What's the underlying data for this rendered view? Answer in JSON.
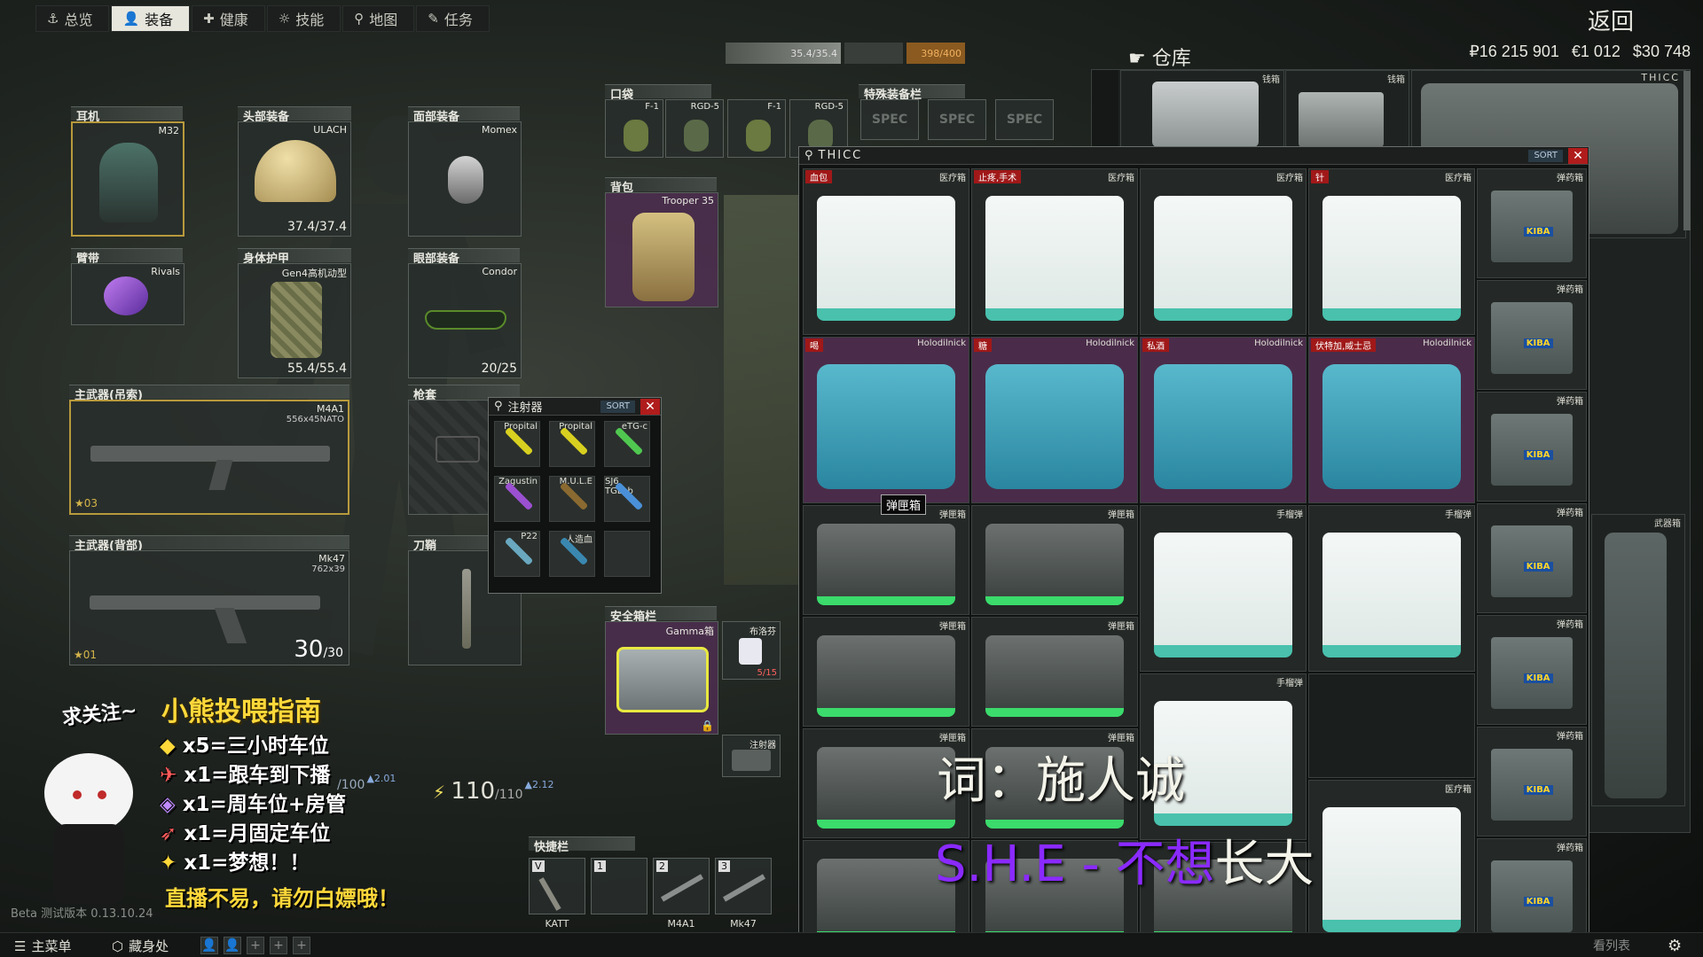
{
  "nav": {
    "tabs": [
      {
        "label": "总览",
        "icon": "anchor-icon"
      },
      {
        "label": "装备",
        "icon": "gear-person-icon"
      },
      {
        "label": "健康",
        "icon": "health-icon"
      },
      {
        "label": "技能",
        "icon": "skill-icon"
      },
      {
        "label": "地图",
        "icon": "map-pin-icon"
      },
      {
        "label": "任务",
        "icon": "task-icon"
      }
    ],
    "back_label": "返回"
  },
  "stash": {
    "title": "仓库",
    "rub": "₽16 215 901",
    "eur": "€1 012",
    "usd": "$30 748",
    "weight": "35.4/35.4",
    "weight2": "398/400"
  },
  "gear": {
    "earpiece": {
      "label": "耳机",
      "name": "M32"
    },
    "headwear": {
      "label": "头部装备",
      "name": "ULACH",
      "durability": "37.4/37.4"
    },
    "faceCover": {
      "label": "面部装备",
      "name": "Momex"
    },
    "armband": {
      "label": "臂带",
      "name": "Rivals"
    },
    "armor": {
      "label": "身体护甲",
      "name": "Gen4高机动型",
      "durability": "55.4/55.4"
    },
    "eyewear": {
      "label": "眼部装备",
      "name": "Condor",
      "durability": "20/25"
    },
    "primary1": {
      "label": "主武器(吊索)",
      "name": "M4A1",
      "caliber": "556x45NATO",
      "badge": "03"
    },
    "primary2": {
      "label": "主武器(背部)",
      "name": "Mk47",
      "caliber": "762x39",
      "badge": "01",
      "ammo": "30",
      "ammo_max": "/30"
    },
    "holster": {
      "label": "枪套"
    },
    "scabbard": {
      "label": "刀鞘"
    },
    "pockets": {
      "label": "口袋",
      "items": [
        "F-1",
        "RGD-5",
        "F-1",
        "RGD-5"
      ]
    },
    "special": {
      "label": "特殊装备栏",
      "items": [
        "SPEC",
        "SPEC",
        "SPEC"
      ]
    },
    "backpack": {
      "label": "背包",
      "name": "Trooper 35"
    },
    "secure": {
      "label": "安全箱栏",
      "name": "Gamma箱"
    },
    "quickbar": {
      "label": "快捷栏",
      "slots": [
        {
          "key": "V",
          "label": "KATT"
        },
        {
          "key": "1",
          "label": ""
        },
        {
          "key": "2",
          "label": "M4A1"
        },
        {
          "key": "3",
          "label": "Mk47"
        }
      ]
    },
    "secure_items": {
      "ibuprofen": "布洛芬",
      "count": "5/15",
      "injector": "注射器"
    }
  },
  "injector_window": {
    "title": "注射器",
    "sort": "SORT",
    "items": [
      "Propital",
      "Propital",
      "eTG-c",
      "Zagustin",
      "M.U.L.E",
      "SJ6 TGLab",
      "P22",
      "人造血"
    ]
  },
  "thicc_window": {
    "title": "THICC",
    "sort": "SORT",
    "row1": [
      {
        "tag": "医疗箱",
        "label": "血包"
      },
      {
        "tag": "医疗箱",
        "label": "止疼,手术"
      },
      {
        "tag": "医疗箱",
        "label": ""
      },
      {
        "tag": "医疗箱",
        "label": "针"
      },
      {
        "tag": "弹药箱",
        "label": ""
      }
    ],
    "row2": [
      {
        "tag": "Holodilnick",
        "label": "喝"
      },
      {
        "tag": "Holodilnick",
        "label": "糖"
      },
      {
        "tag": "Holodilnick",
        "label": "私酒"
      },
      {
        "tag": "Holodilnick",
        "label": "伏特加,威士忌"
      },
      {
        "tag": "弹药箱",
        "label": ""
      }
    ],
    "tooltip": "弹匣箱",
    "ammo_tag": "弹药箱",
    "mag_tag": "弹匣箱",
    "grenade_tag": "手榴弹",
    "med_tag": "医疗箱",
    "weapon_tag": "武器箱"
  },
  "stash_grid": {
    "tag1": "钱箱",
    "tag2": "钱箱",
    "thicc": "THICC"
  },
  "player_stats": {
    "health": "/100",
    "health_delta": "2.01",
    "energy": "110",
    "energy_max": "/110",
    "energy_delta": "2.12"
  },
  "stream_overlay": {
    "follow": "求关注~",
    "title": "小熊投喂指南",
    "lines": [
      "x5=三小时车位",
      "x1=跟车到下播",
      "x1=周车位+房管",
      "x1=月固定车位",
      "x1=梦想！！"
    ],
    "footer": "直播不易，请勿白嫖哦！",
    "lyric1": "词：施人诚",
    "lyric2a": "S.H.E - 不想",
    "lyric2b": "长大"
  },
  "bottom": {
    "menu": "主菜单",
    "hideout": "藏身处",
    "version": "Beta 测试版本 0.13.10.24",
    "right": "看列表"
  }
}
